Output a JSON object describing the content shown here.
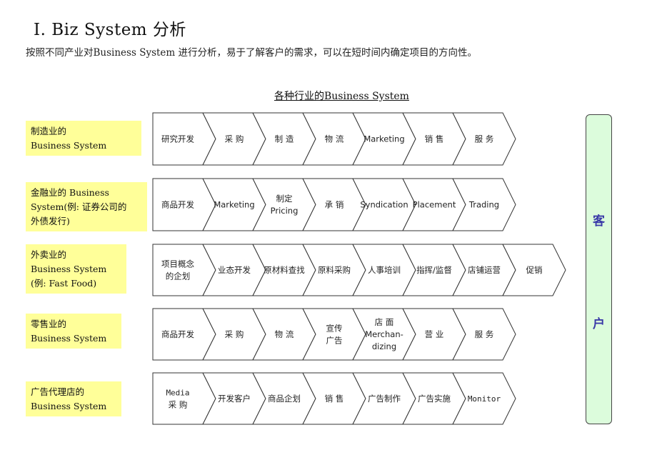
{
  "page": {
    "title": "I. Biz System 分析",
    "subtitle": "按照不同产业对Business System 进行分析，易于了解客户的需求，可以在短时间内确定项目的方向性。",
    "diagram_title": "各种行业的Business System"
  },
  "customer": {
    "chars": [
      "客",
      "户"
    ],
    "fill_color": "#dcfcdc",
    "text_color": "#3a3aa8"
  },
  "colors": {
    "label_fill": "#ffff99"
  },
  "industries": [
    {
      "label_lines": [
        "制造业的",
        "Business System"
      ],
      "steps": [
        [
          "研究开发"
        ],
        [
          "采 购"
        ],
        [
          "制 造"
        ],
        [
          "物 流"
        ],
        [
          "Marketing"
        ],
        [
          "销 售"
        ],
        [
          "服 务"
        ]
      ]
    },
    {
      "label_lines": [
        "金融业的 Business",
        "System(例: 证券公司的",
        "外债发行)"
      ],
      "steps": [
        [
          "商品开发"
        ],
        [
          "Marketing"
        ],
        [
          "制定",
          "Pricing"
        ],
        [
          "承 销"
        ],
        [
          "Syndication"
        ],
        [
          "Placement"
        ],
        [
          "Trading"
        ]
      ]
    },
    {
      "label_lines": [
        "外卖业的",
        "Business System",
        "(例: Fast Food)"
      ],
      "steps": [
        [
          "项目概念",
          "的企划"
        ],
        [
          "业态开发"
        ],
        [
          "原材料查找"
        ],
        [
          "原料采购"
        ],
        [
          "人事培训"
        ],
        [
          "指挥/监督"
        ],
        [
          "店铺运营"
        ],
        [
          "促销"
        ]
      ]
    },
    {
      "label_lines": [
        "零售业的",
        "Business System"
      ],
      "steps": [
        [
          "商品开发"
        ],
        [
          "采 购"
        ],
        [
          "物 流"
        ],
        [
          "宣传",
          "广告"
        ],
        [
          "店 面",
          "Merchan-",
          "dizing"
        ],
        [
          "营 业"
        ],
        [
          "服 务"
        ]
      ]
    },
    {
      "label_lines": [
        "广告代理店的",
        "Business System"
      ],
      "steps": [
        [
          "Media",
          "采 购"
        ],
        [
          "开发客户"
        ],
        [
          "商品企划"
        ],
        [
          "销  售"
        ],
        [
          "广告制作"
        ],
        [
          "广告实施"
        ],
        [
          "Monitor"
        ]
      ]
    }
  ]
}
